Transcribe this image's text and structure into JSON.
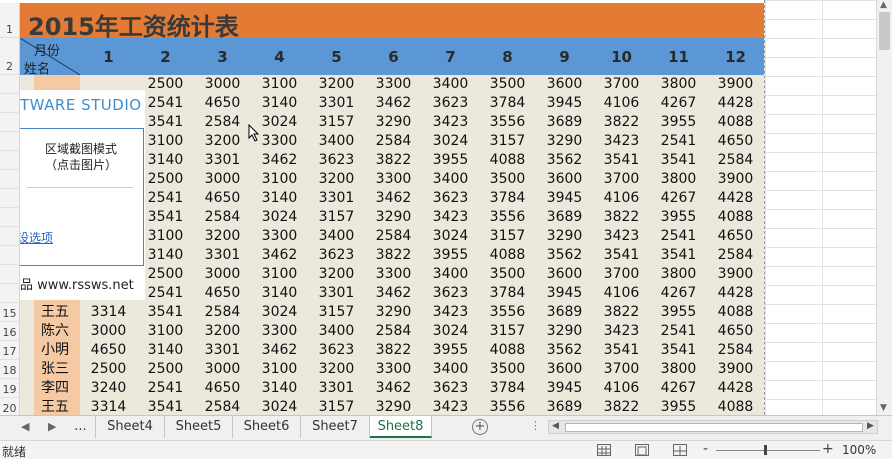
{
  "title": "2015年工资统计表",
  "corner": {
    "month_label": "月份",
    "name_label": "姓名"
  },
  "months": [
    "1",
    "2",
    "3",
    "4",
    "5",
    "6",
    "7",
    "8",
    "9",
    "10",
    "11",
    "12"
  ],
  "visible_rows": [
    {
      "row": "",
      "name": "",
      "month1": "",
      "values": [
        "2500",
        "3000",
        "3100",
        "3200",
        "3300",
        "3400",
        "3500",
        "3600",
        "3700",
        "3800",
        "3900"
      ]
    },
    {
      "row": "",
      "name": "",
      "month1": "",
      "values": [
        "2541",
        "4650",
        "3140",
        "3301",
        "3462",
        "3623",
        "3784",
        "3945",
        "4106",
        "4267",
        "4428"
      ]
    },
    {
      "row": "",
      "name": "",
      "month1": "",
      "values": [
        "3541",
        "2584",
        "3024",
        "3157",
        "3290",
        "3423",
        "3556",
        "3689",
        "3822",
        "3955",
        "4088"
      ]
    },
    {
      "row": "",
      "name": "",
      "month1": "",
      "values": [
        "3100",
        "3200",
        "3300",
        "3400",
        "2584",
        "3024",
        "3157",
        "3290",
        "3423",
        "2541",
        "4650"
      ]
    },
    {
      "row": "",
      "name": "",
      "month1": "",
      "values": [
        "3140",
        "3301",
        "3462",
        "3623",
        "3822",
        "3955",
        "4088",
        "3562",
        "3541",
        "3541",
        "2584"
      ]
    },
    {
      "row": "",
      "name": "",
      "month1": "",
      "values": [
        "2500",
        "3000",
        "3100",
        "3200",
        "3300",
        "3400",
        "3500",
        "3600",
        "3700",
        "3800",
        "3900"
      ]
    },
    {
      "row": "",
      "name": "",
      "month1": "",
      "values": [
        "2541",
        "4650",
        "3140",
        "3301",
        "3462",
        "3623",
        "3784",
        "3945",
        "4106",
        "4267",
        "4428"
      ]
    },
    {
      "row": "",
      "name": "",
      "month1": "",
      "values": [
        "3541",
        "2584",
        "3024",
        "3157",
        "3290",
        "3423",
        "3556",
        "3689",
        "3822",
        "3955",
        "4088"
      ]
    },
    {
      "row": "",
      "name": "",
      "month1": "",
      "values": [
        "3100",
        "3200",
        "3300",
        "3400",
        "2584",
        "3024",
        "3157",
        "3290",
        "3423",
        "2541",
        "4650"
      ]
    },
    {
      "row": "",
      "name": "",
      "month1": "",
      "values": [
        "3140",
        "3301",
        "3462",
        "3623",
        "3822",
        "3955",
        "4088",
        "3562",
        "3541",
        "3541",
        "2584"
      ]
    },
    {
      "row": "",
      "name": "",
      "month1": "",
      "values": [
        "2500",
        "3000",
        "3100",
        "3200",
        "3300",
        "3400",
        "3500",
        "3600",
        "3700",
        "3800",
        "3900"
      ]
    },
    {
      "row": "",
      "name": "",
      "month1": "",
      "values": [
        "2541",
        "4650",
        "3140",
        "3301",
        "3462",
        "3623",
        "3784",
        "3945",
        "4106",
        "4267",
        "4428"
      ]
    },
    {
      "row": "15",
      "name": "王五",
      "month1": "3314",
      "values": [
        "3541",
        "2584",
        "3024",
        "3157",
        "3290",
        "3423",
        "3556",
        "3689",
        "3822",
        "3955",
        "4088"
      ]
    },
    {
      "row": "16",
      "name": "陈六",
      "month1": "3000",
      "values": [
        "3100",
        "3200",
        "3300",
        "3400",
        "2584",
        "3024",
        "3157",
        "3290",
        "3423",
        "2541",
        "4650"
      ]
    },
    {
      "row": "17",
      "name": "小明",
      "month1": "4650",
      "values": [
        "3140",
        "3301",
        "3462",
        "3623",
        "3822",
        "3955",
        "4088",
        "3562",
        "3541",
        "3541",
        "2584"
      ]
    },
    {
      "row": "18",
      "name": "张三",
      "month1": "2500",
      "values": [
        "2500",
        "3000",
        "3100",
        "3200",
        "3300",
        "3400",
        "3500",
        "3600",
        "3700",
        "3800",
        "3900"
      ]
    },
    {
      "row": "19",
      "name": "李四",
      "month1": "3240",
      "values": [
        "2541",
        "4650",
        "3140",
        "3301",
        "3462",
        "3623",
        "3784",
        "3945",
        "4106",
        "4267",
        "4428"
      ]
    },
    {
      "row": "20",
      "name": "王五",
      "month1": "3314",
      "values": [
        "3541",
        "2584",
        "3024",
        "3157",
        "3290",
        "3423",
        "3556",
        "3689",
        "3822",
        "3955",
        "4088"
      ]
    }
  ],
  "header_rows": {
    "row1": "1",
    "row2": "2"
  },
  "overlay": {
    "brand": "TWARE STUDIO",
    "mode_line1": "区域截图模式",
    "mode_line2": "（点击图片）",
    "link": "设选项",
    "site": "品 www.rssws.net"
  },
  "tabs": {
    "ellipsis": "...",
    "items": [
      "Sheet4",
      "Sheet5",
      "Sheet6",
      "Sheet7",
      "Sheet8"
    ],
    "active": "Sheet8"
  },
  "status": {
    "text": "就绪",
    "zoom": "100%",
    "minus": "-",
    "plus": "+"
  },
  "colors": {
    "title_bg": "#e37b35",
    "header_bg": "#5b97d4",
    "body_bg": "#ece9dc",
    "name_bg": "#f4c9a4",
    "active_tab": "#217346"
  }
}
